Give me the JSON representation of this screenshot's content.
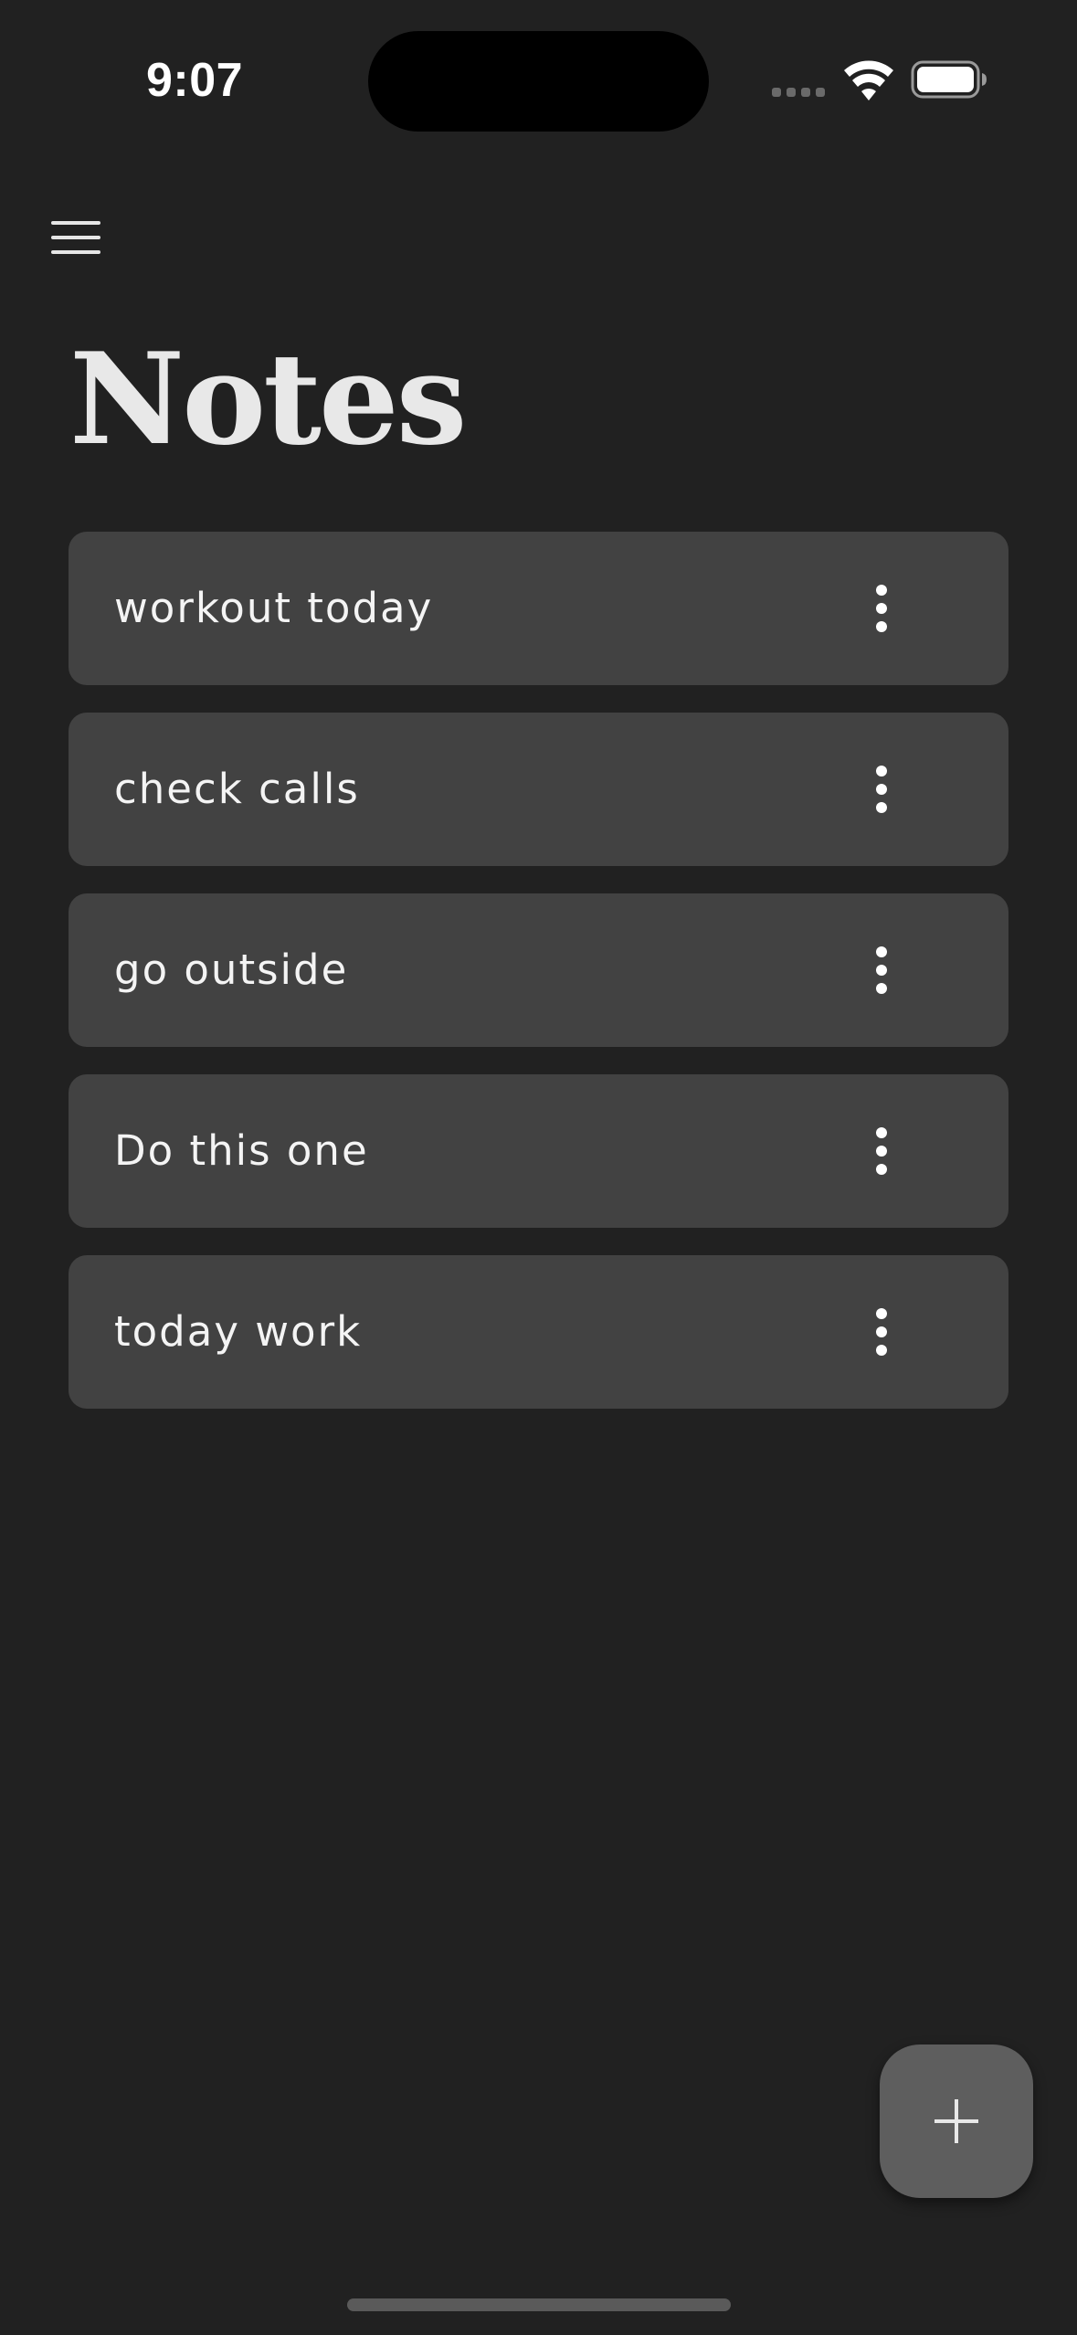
{
  "status_bar": {
    "time": "9:07",
    "icons": [
      "cellular-signal-icon",
      "wifi-icon",
      "battery-icon"
    ]
  },
  "header": {
    "menu_icon": "hamburger-menu-icon",
    "title": "Notes"
  },
  "notes": [
    {
      "title": "workout today",
      "menu_icon": "more-vertical-icon"
    },
    {
      "title": "check calls",
      "menu_icon": "more-vertical-icon"
    },
    {
      "title": "go outside",
      "menu_icon": "more-vertical-icon"
    },
    {
      "title": "Do this one",
      "menu_icon": "more-vertical-icon"
    },
    {
      "title": "today work",
      "menu_icon": "more-vertical-icon"
    }
  ],
  "fab": {
    "icon": "plus-icon"
  },
  "colors": {
    "background": "#212121",
    "card": "#424242",
    "fab": "#5e5e5e",
    "text": "#f4f4f4"
  }
}
